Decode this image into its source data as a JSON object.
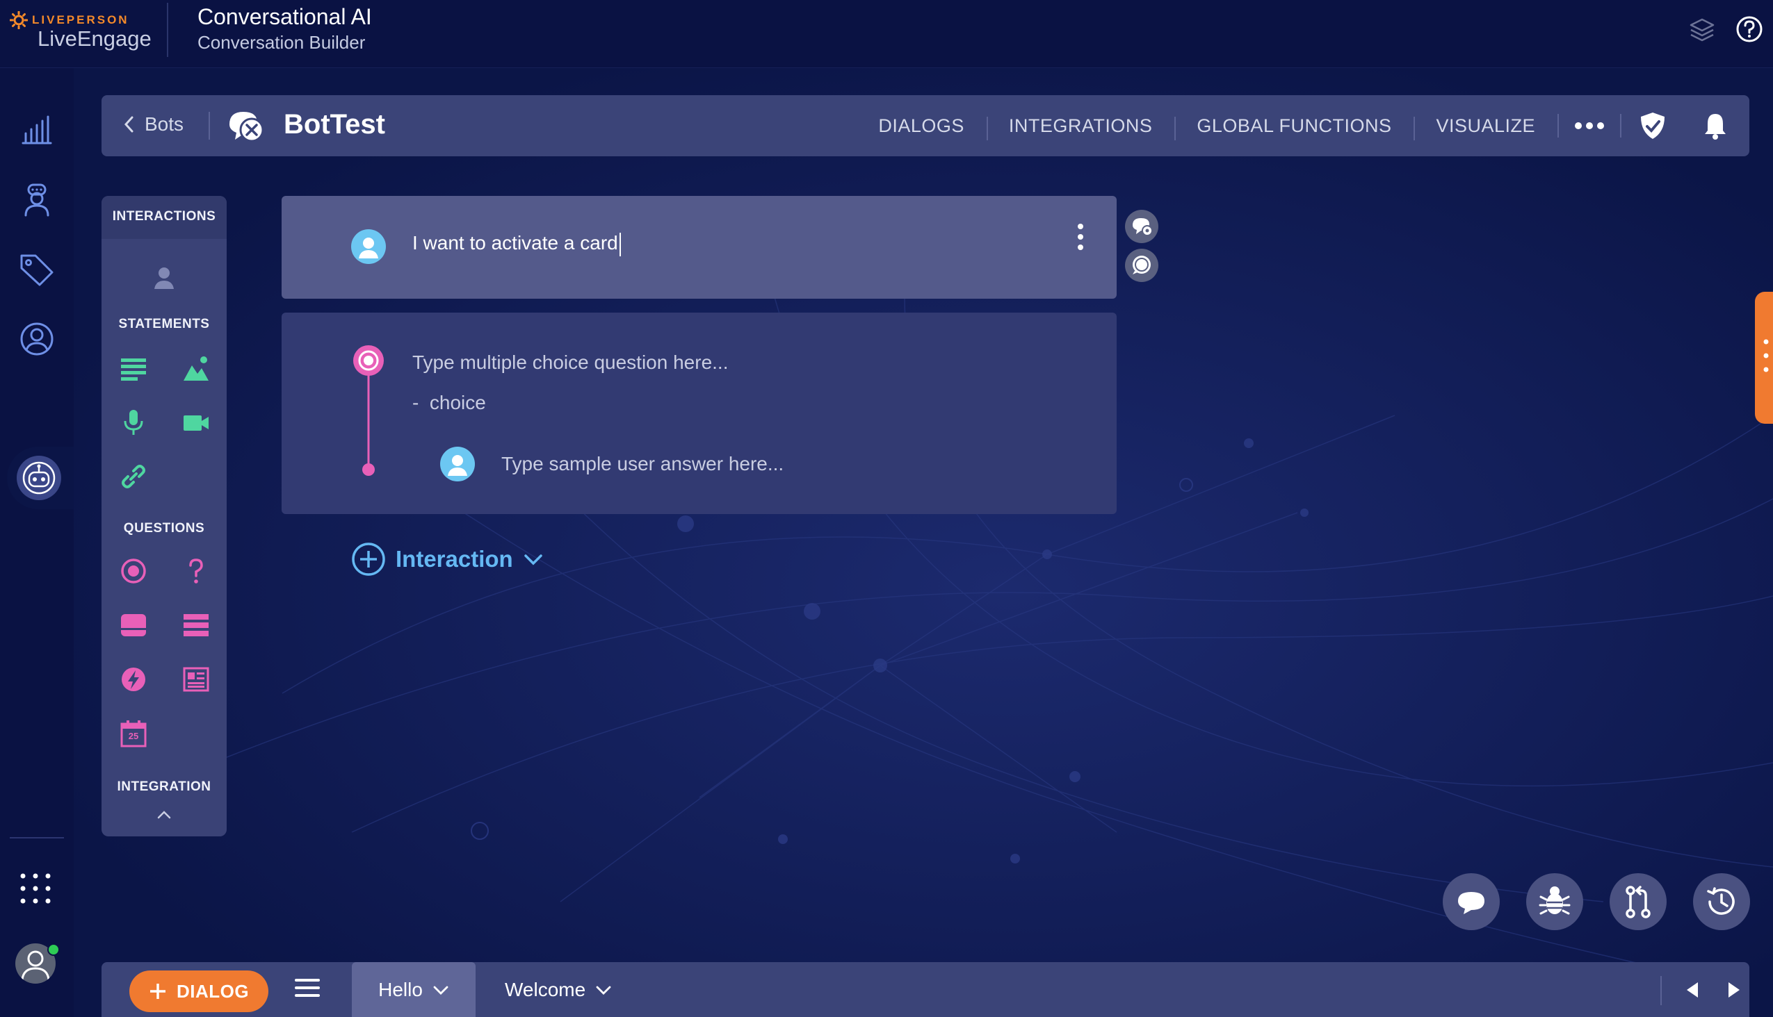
{
  "header": {
    "brand_top": "LIVEPERSON",
    "brand_bottom": "LiveEngage",
    "title": "Conversational AI",
    "subtitle": "Conversation Builder",
    "icons": [
      "layers-icon",
      "help-icon"
    ]
  },
  "rail": {
    "items": [
      "analytics-icon",
      "agent-icon",
      "tag-icon",
      "user-icon",
      "bot-icon"
    ],
    "active": "bot-icon",
    "bottom": [
      "apps-grid-icon",
      "avatar"
    ]
  },
  "botbar": {
    "back_label": "Bots",
    "bot_name": "BotTest",
    "nav": [
      "DIALOGS",
      "INTEGRATIONS",
      "GLOBAL FUNCTIONS",
      "VISUALIZE"
    ],
    "icons": [
      "more-icon",
      "shield-icon",
      "bell-icon"
    ]
  },
  "palette": {
    "header": "INTERACTIONS",
    "sections": {
      "statements": "STATEMENTS",
      "questions": "QUESTIONS",
      "integration": "INTEGRATION"
    },
    "calendar_day": "25"
  },
  "dialog": {
    "statement_text": "I want to activate a card",
    "question_placeholder": "Type multiple choice question here...",
    "choice_label": "choice",
    "choice_prefix": "-",
    "user_answer_placeholder": "Type sample user answer here...",
    "add_interaction_label": "Interaction"
  },
  "bottombar": {
    "dialog_button": "DIALOG",
    "tabs": [
      "Hello",
      "Welcome"
    ]
  },
  "colors": {
    "background": "#0b1547",
    "bar": "#3b4478",
    "accent_orange": "#f07a30",
    "statement_green": "#4fd6a0",
    "question_pink": "#e860b8",
    "link_blue": "#65b8f3"
  }
}
